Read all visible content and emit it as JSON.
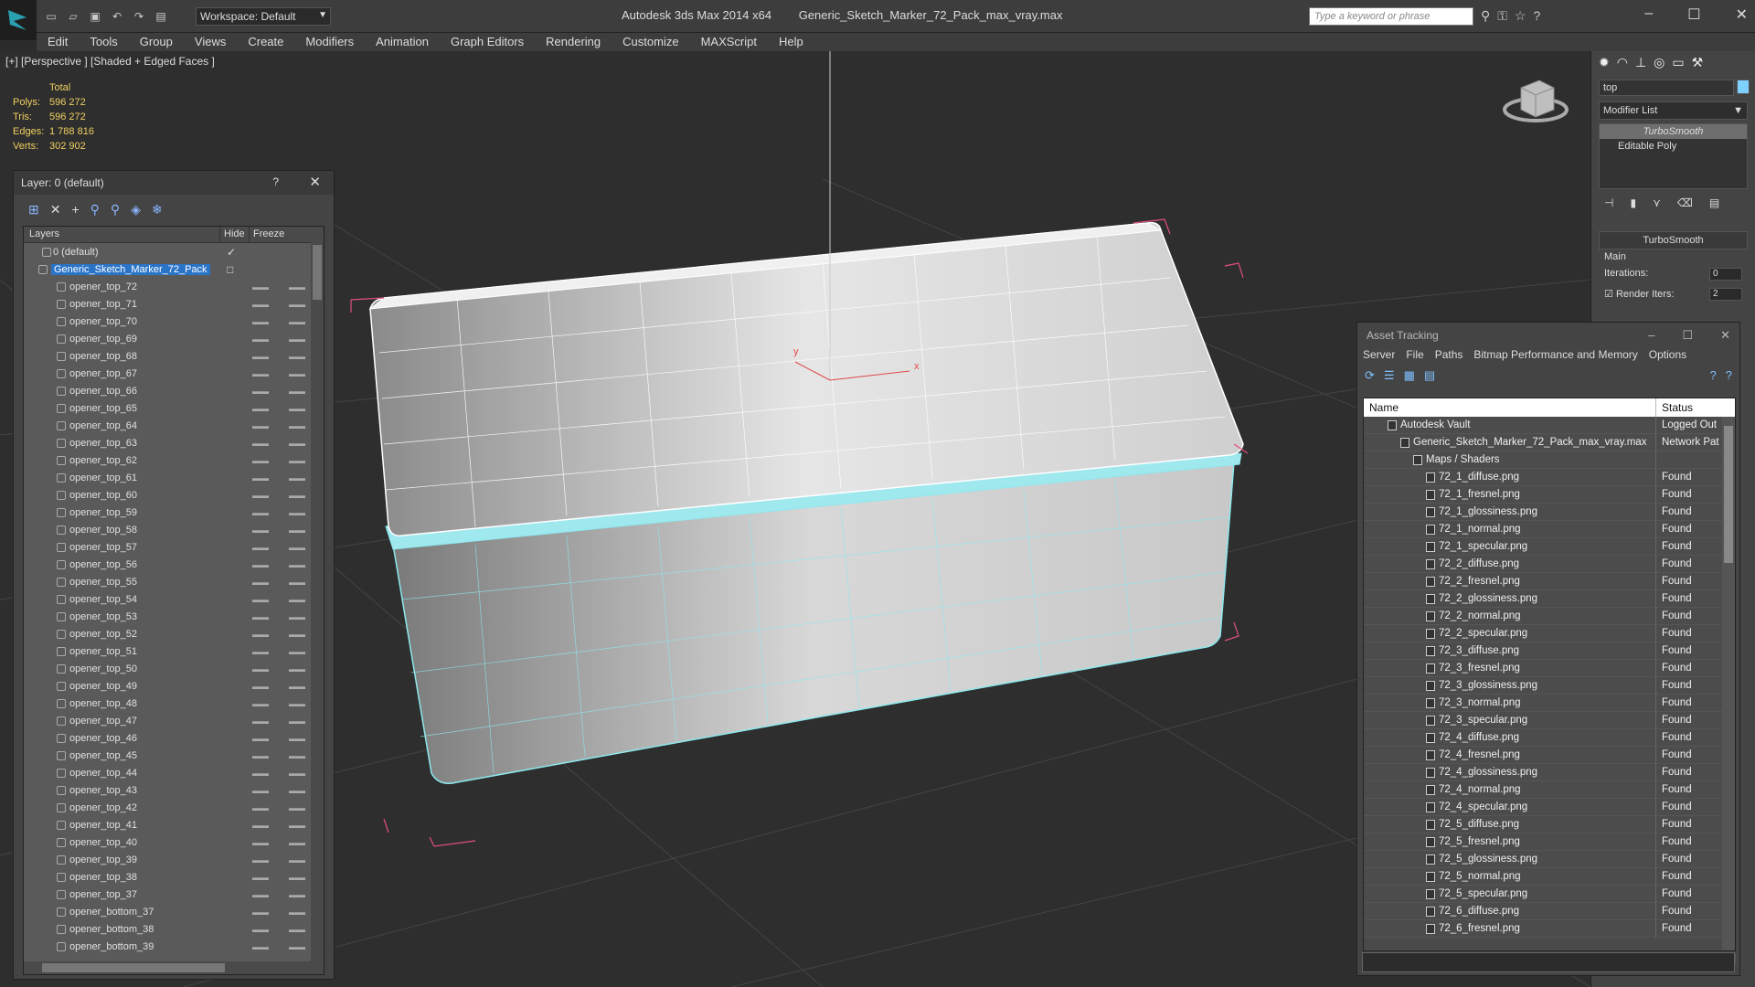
{
  "app": {
    "title": "Autodesk 3ds Max  2014 x64",
    "file": "Generic_Sketch_Marker_72_Pack_max_vray.max",
    "workspace": "Workspace: Default",
    "search_placeholder": "Type a keyword or phrase"
  },
  "menu": [
    "Edit",
    "Tools",
    "Group",
    "Views",
    "Create",
    "Modifiers",
    "Animation",
    "Graph Editors",
    "Rendering",
    "Customize",
    "MAXScript",
    "Help"
  ],
  "viewport": {
    "label": "[+] [Perspective ] [Shaded + Edged Faces ]",
    "stats": {
      "header": "Total",
      "rows": [
        {
          "k": "Polys:",
          "v": "596 272"
        },
        {
          "k": "Tris:",
          "v": "596 272"
        },
        {
          "k": "Edges:",
          "v": "1 788 816"
        },
        {
          "k": "Verts:",
          "v": "302 902"
        }
      ]
    }
  },
  "layer_dialog": {
    "title": "Layer: 0 (default)",
    "help": "?",
    "close": "✕",
    "col_layers": "Layers",
    "col_hide": "Hide",
    "col_freeze": "Freeze",
    "default_layer": "0 (default)",
    "selected_layer": "Generic_Sketch_Marker_72_Pack",
    "items": [
      "opener_top_72",
      "opener_top_71",
      "opener_top_70",
      "opener_top_69",
      "opener_top_68",
      "opener_top_67",
      "opener_top_66",
      "opener_top_65",
      "opener_top_64",
      "opener_top_63",
      "opener_top_62",
      "opener_top_61",
      "opener_top_60",
      "opener_top_59",
      "opener_top_58",
      "opener_top_57",
      "opener_top_56",
      "opener_top_55",
      "opener_top_54",
      "opener_top_53",
      "opener_top_52",
      "opener_top_51",
      "opener_top_50",
      "opener_top_49",
      "opener_top_48",
      "opener_top_47",
      "opener_top_46",
      "opener_top_45",
      "opener_top_44",
      "opener_top_43",
      "opener_top_42",
      "opener_top_41",
      "opener_top_40",
      "opener_top_39",
      "opener_top_38",
      "opener_top_37",
      "opener_bottom_37",
      "opener_bottom_38",
      "opener_bottom_39"
    ]
  },
  "command_panel": {
    "name_field": "top",
    "modifier_list": "Modifier List",
    "stack": [
      "TurboSmooth",
      "Editable Poly"
    ],
    "rollout_title": "TurboSmooth",
    "group": "Main",
    "iterations_label": "Iterations:",
    "iterations_value": "0",
    "render_iters_label": "Render Iters:",
    "render_iters_value": "2"
  },
  "asset_tracking": {
    "title": "Asset Tracking",
    "menu": [
      "Server",
      "File",
      "Paths",
      "Bitmap Performance and Memory",
      "Options"
    ],
    "col_name": "Name",
    "col_status": "Status",
    "rows": [
      {
        "name": "Autodesk Vault",
        "status": "Logged Out",
        "indent": 1
      },
      {
        "name": "Generic_Sketch_Marker_72_Pack_max_vray.max",
        "status": "Network Pat",
        "indent": 2
      },
      {
        "name": "Maps / Shaders",
        "status": "",
        "indent": 3
      },
      {
        "name": "72_1_diffuse.png",
        "status": "Found",
        "indent": 4
      },
      {
        "name": "72_1_fresnel.png",
        "status": "Found",
        "indent": 4
      },
      {
        "name": "72_1_glossiness.png",
        "status": "Found",
        "indent": 4
      },
      {
        "name": "72_1_normal.png",
        "status": "Found",
        "indent": 4
      },
      {
        "name": "72_1_specular.png",
        "status": "Found",
        "indent": 4
      },
      {
        "name": "72_2_diffuse.png",
        "status": "Found",
        "indent": 4
      },
      {
        "name": "72_2_fresnel.png",
        "status": "Found",
        "indent": 4
      },
      {
        "name": "72_2_glossiness.png",
        "status": "Found",
        "indent": 4
      },
      {
        "name": "72_2_normal.png",
        "status": "Found",
        "indent": 4
      },
      {
        "name": "72_2_specular.png",
        "status": "Found",
        "indent": 4
      },
      {
        "name": "72_3_diffuse.png",
        "status": "Found",
        "indent": 4
      },
      {
        "name": "72_3_fresnel.png",
        "status": "Found",
        "indent": 4
      },
      {
        "name": "72_3_glossiness.png",
        "status": "Found",
        "indent": 4
      },
      {
        "name": "72_3_normal.png",
        "status": "Found",
        "indent": 4
      },
      {
        "name": "72_3_specular.png",
        "status": "Found",
        "indent": 4
      },
      {
        "name": "72_4_diffuse.png",
        "status": "Found",
        "indent": 4
      },
      {
        "name": "72_4_fresnel.png",
        "status": "Found",
        "indent": 4
      },
      {
        "name": "72_4_glossiness.png",
        "status": "Found",
        "indent": 4
      },
      {
        "name": "72_4_normal.png",
        "status": "Found",
        "indent": 4
      },
      {
        "name": "72_4_specular.png",
        "status": "Found",
        "indent": 4
      },
      {
        "name": "72_5_diffuse.png",
        "status": "Found",
        "indent": 4
      },
      {
        "name": "72_5_fresnel.png",
        "status": "Found",
        "indent": 4
      },
      {
        "name": "72_5_glossiness.png",
        "status": "Found",
        "indent": 4
      },
      {
        "name": "72_5_normal.png",
        "status": "Found",
        "indent": 4
      },
      {
        "name": "72_5_specular.png",
        "status": "Found",
        "indent": 4
      },
      {
        "name": "72_6_diffuse.png",
        "status": "Found",
        "indent": 4
      },
      {
        "name": "72_6_fresnel.png",
        "status": "Found",
        "indent": 4
      }
    ]
  },
  "colors": {
    "accent": "#2a74c8",
    "stats": "#f0d060",
    "wire_top": "#ffffff",
    "wire_bottom": "#8ee8ee",
    "bbox": "#e0507a"
  }
}
